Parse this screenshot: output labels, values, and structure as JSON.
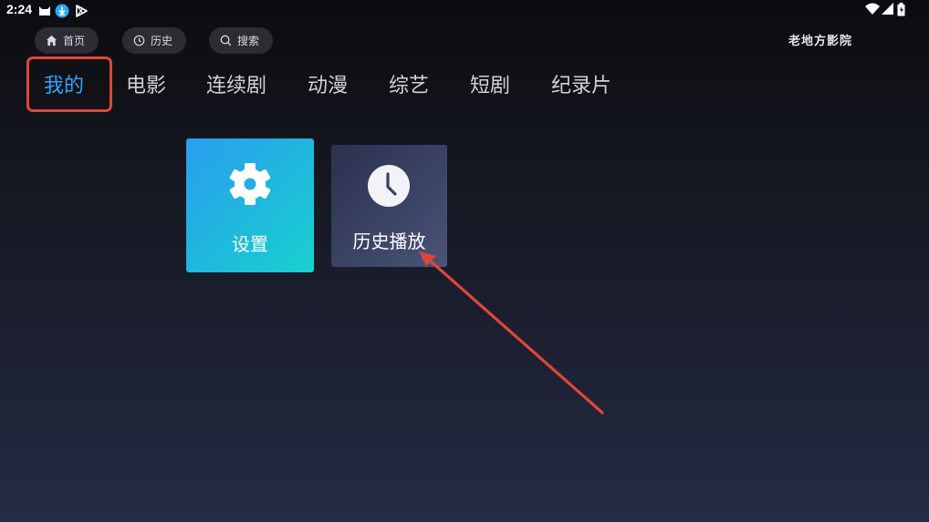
{
  "status_bar": {
    "time": "2:24",
    "left_icons": [
      "cat-icon",
      "download-icon",
      "play-store-icon"
    ],
    "right_icons": [
      "wifi-icon",
      "signal-icon",
      "battery-icon"
    ]
  },
  "top_nav": {
    "home_label": "首页",
    "history_label": "历史",
    "search_label": "搜索"
  },
  "brand": {
    "name": "老地方影院"
  },
  "tabs": [
    {
      "label": "我的",
      "active": true
    },
    {
      "label": "电影",
      "active": false
    },
    {
      "label": "连续剧",
      "active": false
    },
    {
      "label": "动漫",
      "active": false
    },
    {
      "label": "综艺",
      "active": false
    },
    {
      "label": "短剧",
      "active": false
    },
    {
      "label": "纪录片",
      "active": false
    }
  ],
  "tiles": {
    "settings": {
      "label": "设置",
      "icon": "gear-icon"
    },
    "history": {
      "label": "历史播放",
      "icon": "clock-icon"
    }
  },
  "colors": {
    "active_tab": "#2fa3ff",
    "highlight": "#e04638",
    "arrow": "#e04638"
  }
}
